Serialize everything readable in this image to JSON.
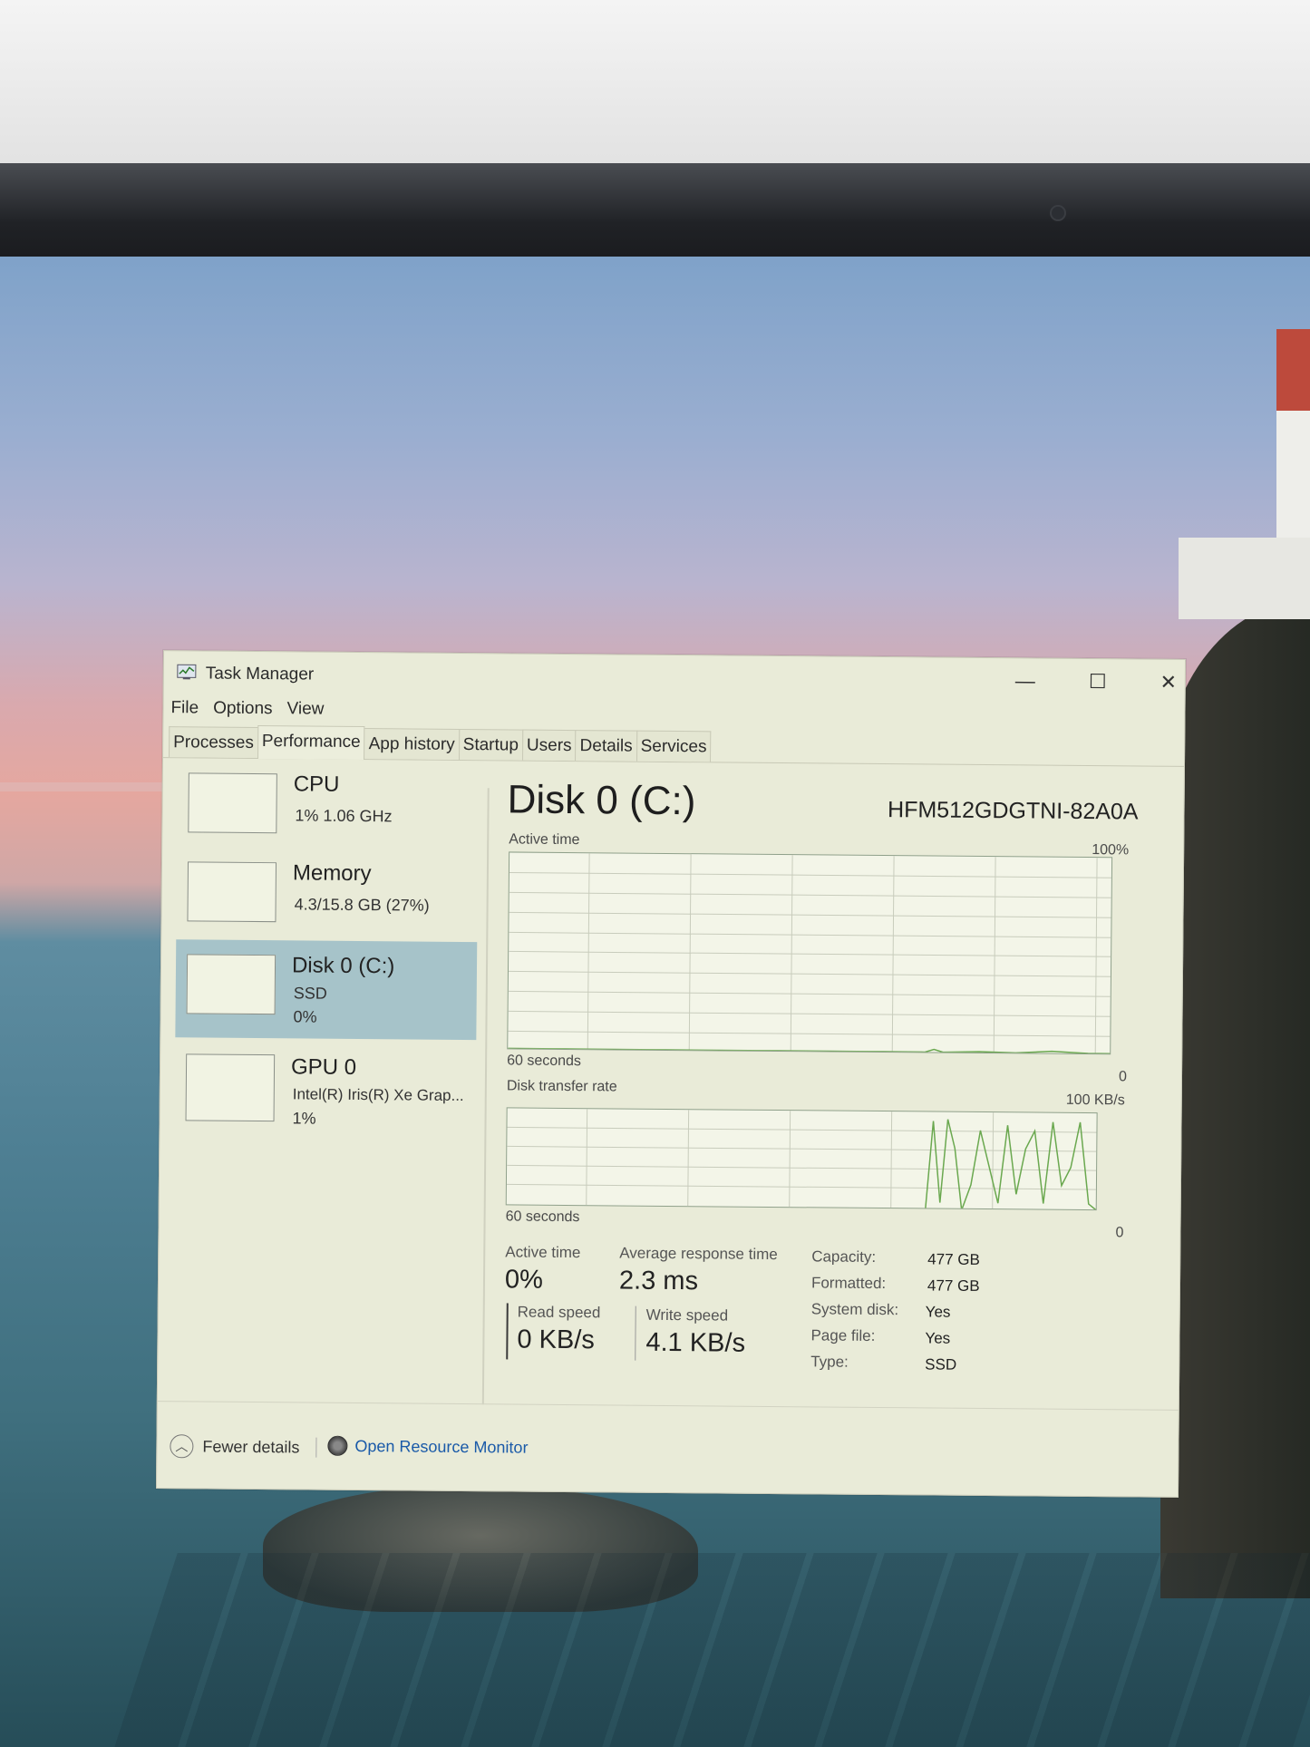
{
  "window": {
    "title": "Task Manager",
    "minimize_glyph": "—",
    "maximize_glyph": "☐",
    "close_glyph": "✕"
  },
  "menu": [
    "File",
    "Options",
    "View"
  ],
  "tabs": [
    "Processes",
    "Performance",
    "App history",
    "Startup",
    "Users",
    "Details",
    "Services"
  ],
  "active_tab": "Performance",
  "sidebar": {
    "items": [
      {
        "name": "CPU",
        "line1": "1%  1.06 GHz",
        "line2": ""
      },
      {
        "name": "Memory",
        "line1": "4.3/15.8 GB (27%)",
        "line2": ""
      },
      {
        "name": "Disk 0 (C:)",
        "line1": "SSD",
        "line2": "0%"
      },
      {
        "name": "GPU 0",
        "line1": "Intel(R) Iris(R) Xe Grap...",
        "line2": "1%"
      }
    ],
    "selected_index": 2
  },
  "detail": {
    "title": "Disk 0 (C:)",
    "model": "HFM512GDGTNI-82A0A",
    "active_time_graph": {
      "label": "Active time",
      "max_label": "100%",
      "min_label": "0",
      "time_label": "60 seconds"
    },
    "transfer_graph": {
      "label": "Disk transfer rate",
      "max_label": "100 KB/s",
      "min_label": "0",
      "time_label": "60 seconds"
    },
    "stats": {
      "active_time_label": "Active time",
      "active_time_value": "0%",
      "avg_response_label": "Average response time",
      "avg_response_value": "2.3 ms",
      "read_speed_label": "Read speed",
      "read_speed_value": "0 KB/s",
      "write_speed_label": "Write speed",
      "write_speed_value": "4.1 KB/s"
    },
    "properties": [
      {
        "key": "Capacity:",
        "value": "477 GB"
      },
      {
        "key": "Formatted:",
        "value": "477 GB"
      },
      {
        "key": "System disk:",
        "value": "Yes"
      },
      {
        "key": "Page file:",
        "value": "Yes"
      },
      {
        "key": "Type:",
        "value": "SSD"
      }
    ]
  },
  "footer": {
    "fewer_details": "Fewer details",
    "open_resource_monitor": "Open Resource Monitor"
  },
  "colors": {
    "graph_line": "#6aa84f",
    "selected_bg": "#a6c3c9",
    "link": "#1a5aa8"
  }
}
